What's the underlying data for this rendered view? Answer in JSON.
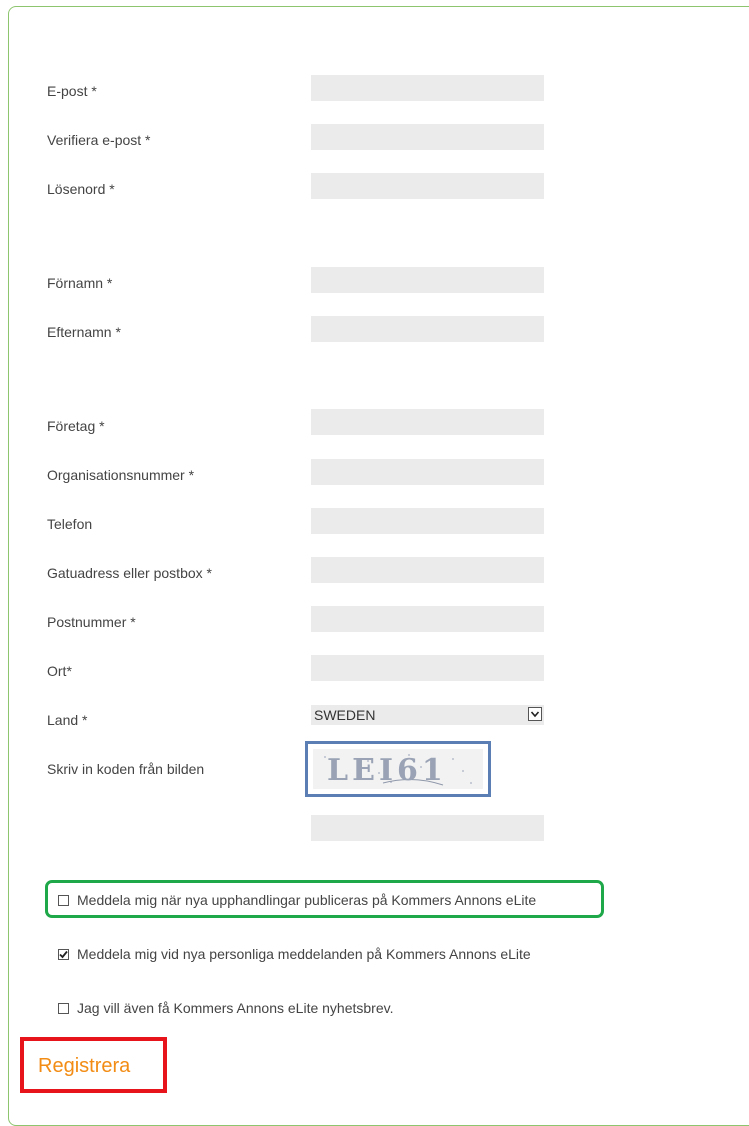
{
  "form": {
    "fields": [
      {
        "label": "E-post *",
        "value": ""
      },
      {
        "label": "Verifiera e-post *",
        "value": ""
      },
      {
        "label": "Lösenord *",
        "value": ""
      },
      {
        "label": "Förnamn *",
        "value": ""
      },
      {
        "label": "Efternamn *",
        "value": ""
      },
      {
        "label": "Företag *",
        "value": ""
      },
      {
        "label": "Organisationsnummer *",
        "value": ""
      },
      {
        "label": "Telefon",
        "value": ""
      },
      {
        "label": "Gatuadress eller postbox *",
        "value": ""
      },
      {
        "label": "Postnummer *",
        "value": ""
      },
      {
        "label": "Ort*",
        "value": ""
      }
    ],
    "country": {
      "label": "Land *",
      "selected": "SWEDEN"
    },
    "captcha": {
      "label": "Skriv in koden från bilden",
      "image_text": "LEI61",
      "value": ""
    },
    "checkboxes": [
      {
        "label": "Meddela mig när nya upphandlingar publiceras på Kommers Annons eLite",
        "checked": false
      },
      {
        "label": "Meddela mig vid nya personliga meddelanden på Kommers Annons eLite",
        "checked": true
      },
      {
        "label": "Jag vill även få Kommers Annons eLite nyhetsbrev.",
        "checked": false
      }
    ],
    "submit_label": "Registrera"
  },
  "colors": {
    "panel_border": "#8cc56e",
    "field_bg": "#ebebeb",
    "captcha_highlight": "#5b7fb5",
    "checkbox_highlight": "#1ea84a",
    "submit_highlight": "#e8141c",
    "submit_text": "#f28c14"
  }
}
